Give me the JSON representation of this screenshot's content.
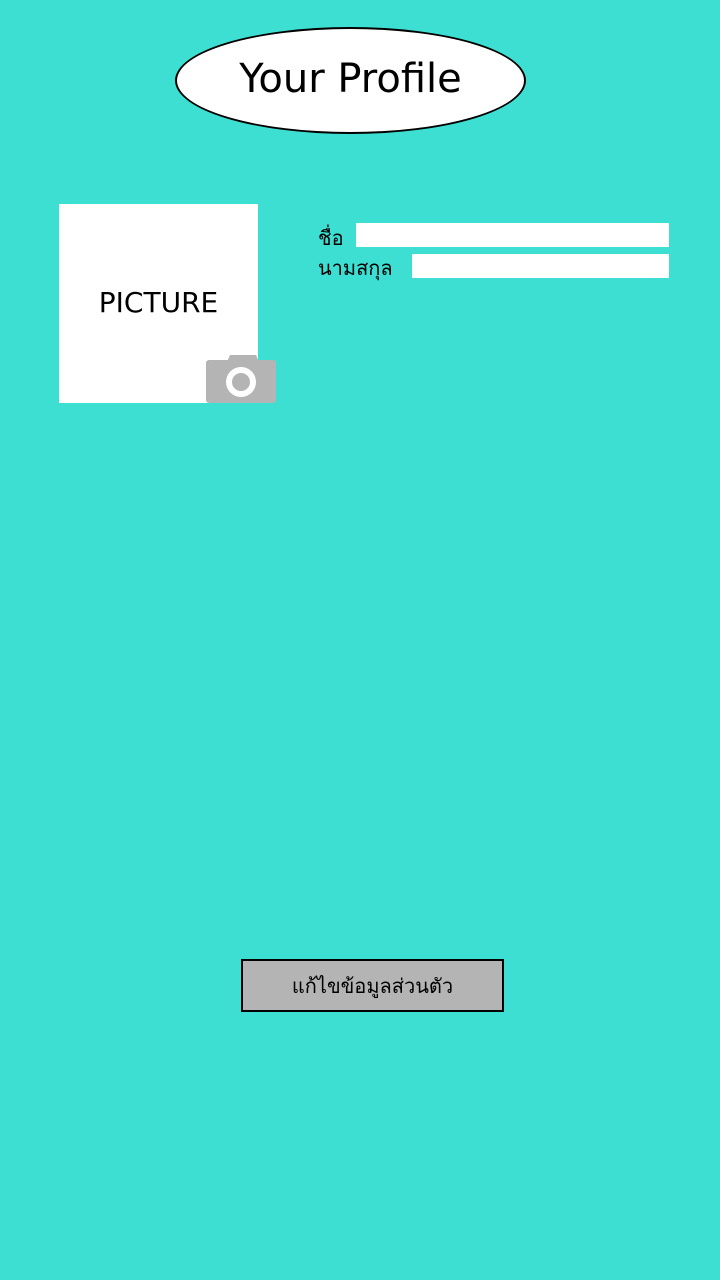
{
  "header": {
    "title": "Your Profile"
  },
  "profile_picture": {
    "placeholder_label": "PICTURE",
    "camera_icon": "camera-icon",
    "camera_color": "#b4b4b4"
  },
  "form": {
    "first_name_label": "ชื่อ",
    "first_name_value": "",
    "last_name_label": "นามสกุล",
    "last_name_value": ""
  },
  "actions": {
    "edit_label": "แก้ไขข้อมูลส่วนตัว"
  },
  "colors": {
    "background": "#3cdfd1",
    "panel": "#ffffff",
    "button": "#b4b4b4"
  }
}
